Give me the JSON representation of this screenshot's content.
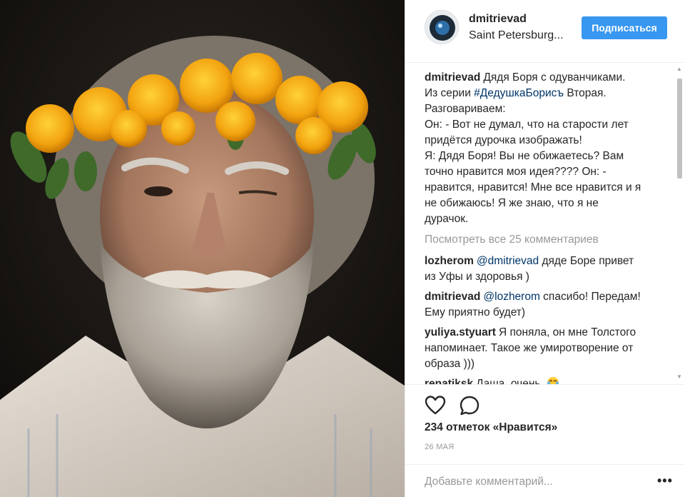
{
  "header": {
    "username": "dmitrievad",
    "location": "Saint Petersburg...",
    "follow_label": "Подписаться"
  },
  "caption": {
    "author": "dmitrievad",
    "line1_text": "Дядя Боря с одуванчиками.",
    "line2_prefix": "Из серии ",
    "hashtag": "#ДедушкаБорисъ",
    "line2_suffix": " Вторая.",
    "line3": "Разговариваем:",
    "line4": "Он: - Вот не думал, что на старости лет",
    "line5": "придётся дурочка изображать!",
    "line6": "Я: Дядя Боря! Вы не обижаетесь? Вам",
    "line7": "точно нравится моя идея???? Он: -",
    "line8": "нравится, нравится! Мне все нравится и я",
    "line9": "не обижаюсь! Я же знаю, что я не",
    "line10": "дурачок."
  },
  "view_all_comments": "Посмотреть все 25 комментариев",
  "comments": [
    {
      "author": "lozherom",
      "mention": "@dmitrievad",
      "line1": " дяде Боре привет",
      "line2": "из Уфы и здоровья )"
    },
    {
      "author": "dmitrievad",
      "mention": "@lozherom",
      "line1": " спасибо! Передам!",
      "line2": "Ему приятно будет)"
    },
    {
      "author": "yuliya.styuart",
      "line1": "Я поняла, он мне Толстого",
      "line2": "напоминает. Такое же умиротворение от",
      "line3": "образа )))"
    },
    {
      "author": "renatiksk",
      "line1": "Даша, очень"
    }
  ],
  "likes": "234 отметок «Нравится»",
  "date": "26 МАЯ",
  "add_comment_placeholder": "Добавьте комментарий...",
  "more_label": "•••",
  "icons": {
    "like": "heart-outline-icon",
    "comment": "speech-bubble-icon",
    "more": "ellipsis-icon",
    "emoji": "crying-laughing-emoji-icon"
  },
  "colors": {
    "follow_button": "#3897f0",
    "link": "#003569",
    "muted": "#999999",
    "text": "#262626"
  }
}
